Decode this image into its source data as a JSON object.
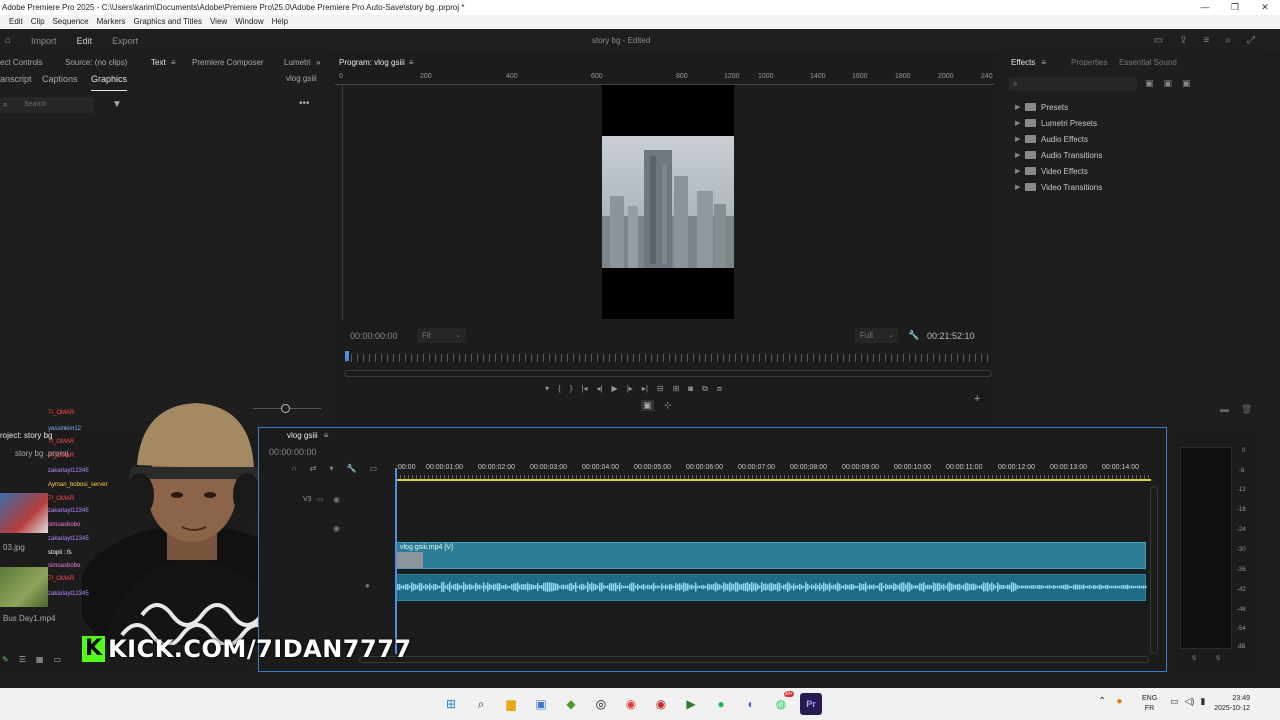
{
  "window": {
    "title": "Adobe Premiere Pro 2025 - C:\\Users\\karim\\Documents\\Adobe\\Premiere Pro\\25.0\\Adobe Premiere Pro Auto-Save\\story bg .prproj *",
    "minimize": "—",
    "restore": "❐",
    "close": "✕"
  },
  "menu": [
    "Edit",
    "Clip",
    "Sequence",
    "Markers",
    "Graphics and Titles",
    "View",
    "Window",
    "Help"
  ],
  "workspace": {
    "import": "Import",
    "edit": "Edit",
    "export": "Export",
    "project_title": "story bg - Edited"
  },
  "left_panel": {
    "tabs": [
      "ect Controls",
      "Source: (no clips)",
      "Text",
      "Premiere Composer",
      "Lumetri"
    ],
    "subtabs": [
      "anscript",
      "Captions",
      "Graphics"
    ],
    "sequence_name": "vlog gsiii",
    "search_placeholder": "Search"
  },
  "program_monitor": {
    "title": "Program: vlog gsiii",
    "ruler_labels": [
      "0",
      "200",
      "400",
      "600",
      "800",
      "1000",
      "1200",
      "1400",
      "1600",
      "1800",
      "2000",
      "2200",
      "240"
    ],
    "timecode_left": "00:00:00:00",
    "fit": "Fit",
    "quality": "Full",
    "timecode_right": "00:21:52:10"
  },
  "effects_panel": {
    "tabs": [
      "Effects",
      "Properties",
      "Essential Sound"
    ],
    "items": [
      "Presets",
      "Lumetri Presets",
      "Audio Effects",
      "Audio Transitions",
      "Video Effects",
      "Video Transitions"
    ]
  },
  "project_panel": {
    "title": "roject: story bg",
    "file": "story bg .prproj",
    "clips": [
      "03.jpg",
      "Bus Day1.mp4"
    ]
  },
  "timeline": {
    "title": "vlog gsiii",
    "timecode": "00:00:00:00",
    "ruler": [
      ":00:00",
      "00:00:01:00",
      "00:00:02:00",
      "00:00:03:00",
      "00:00:04:00",
      "00:00:05:00",
      "00:00:06:00",
      "00:00:07:00",
      "00:00:08:00",
      "00:00:09:00",
      "00:00:10:00",
      "00:00:11:00",
      "00:00:12:00",
      "00:00:13:00",
      "00:00:14:00"
    ],
    "track_v3": "V3",
    "video_clip": "vlog gsiii.mp4 [V]"
  },
  "audio_meter": {
    "labels": [
      "0",
      "-6",
      "-12",
      "-18",
      "-24",
      "-30",
      "-36",
      "-42",
      "-48",
      "-54",
      "dB"
    ],
    "bottom": [
      "S",
      "S"
    ]
  },
  "overlay": {
    "kick_text": "KICK.COM/7IDAN7777",
    "kick_logo": "K",
    "chat": [
      {
        "name": "7I_OMAR",
        "color": "#ff4c4c"
      },
      {
        "name": "yassinkim12",
        "color": "#7fb5ff"
      },
      {
        "name": "7I_OMAR",
        "color": "#ff4c4c"
      },
      {
        "name": "7I_OMAR",
        "color": "#ff4c4c"
      },
      {
        "name": "zakariayt12345",
        "color": "#b48cff"
      },
      {
        "name": "Ayman_bobosi_server",
        "color": "#ffd04c"
      },
      {
        "name": "7I_OMAR",
        "color": "#ff4c4c"
      },
      {
        "name": "zakariayt12345",
        "color": "#b48cff"
      },
      {
        "name": "simoasbobo",
        "color": "#ff7ce0"
      },
      {
        "name": "zakariayt12345",
        "color": "#b48cff"
      },
      {
        "name": "stopli : fs",
        "color": "#ffffff"
      },
      {
        "name": "simoasbobo",
        "color": "#ff7ce0"
      },
      {
        "name": "7I_OMAR",
        "color": "#ff4c4c"
      },
      {
        "name": "zakariayt12345",
        "color": "#b48cff"
      }
    ]
  },
  "taskbar": {
    "lang_top": "ENG",
    "lang_bottom": "FR",
    "time": "23:49",
    "date": "2025-10-12",
    "badge": "99+"
  }
}
